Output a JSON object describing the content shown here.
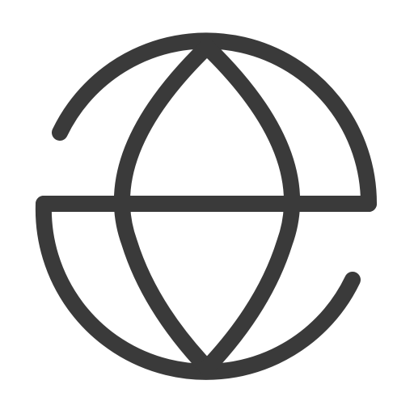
{
  "icon": {
    "name": "globe-icon",
    "stroke_color": "#3a3a3a",
    "background_color": "#ffffff"
  }
}
